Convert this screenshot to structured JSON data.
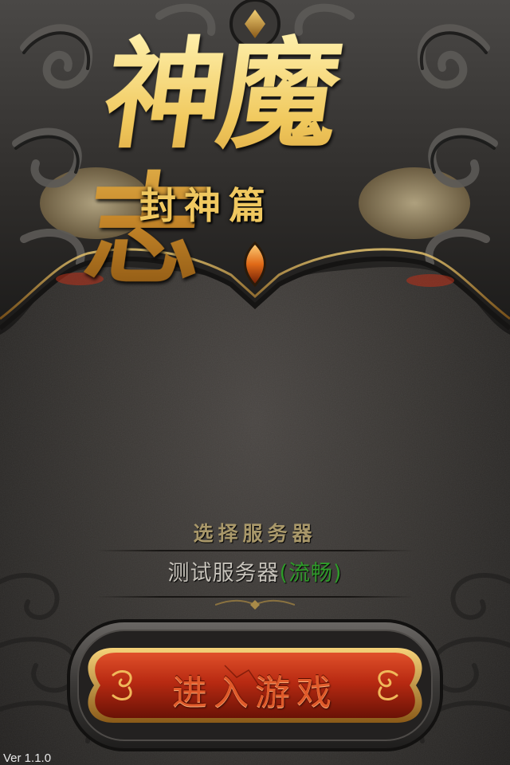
{
  "logo": {
    "title": "神魔志",
    "subtitle": "封神篇"
  },
  "server_select": {
    "title": "选择服务器",
    "server_name": "测试服务器",
    "server_status": "(流畅)"
  },
  "enter_button": {
    "label": "进入游戏"
  },
  "footer": {
    "version": "Ver 1.1.0"
  },
  "colors": {
    "gold": "#e9c36a",
    "status_green": "#2f9a2a",
    "button_red": "#c8361a",
    "label_orange": "#e05a2a"
  }
}
